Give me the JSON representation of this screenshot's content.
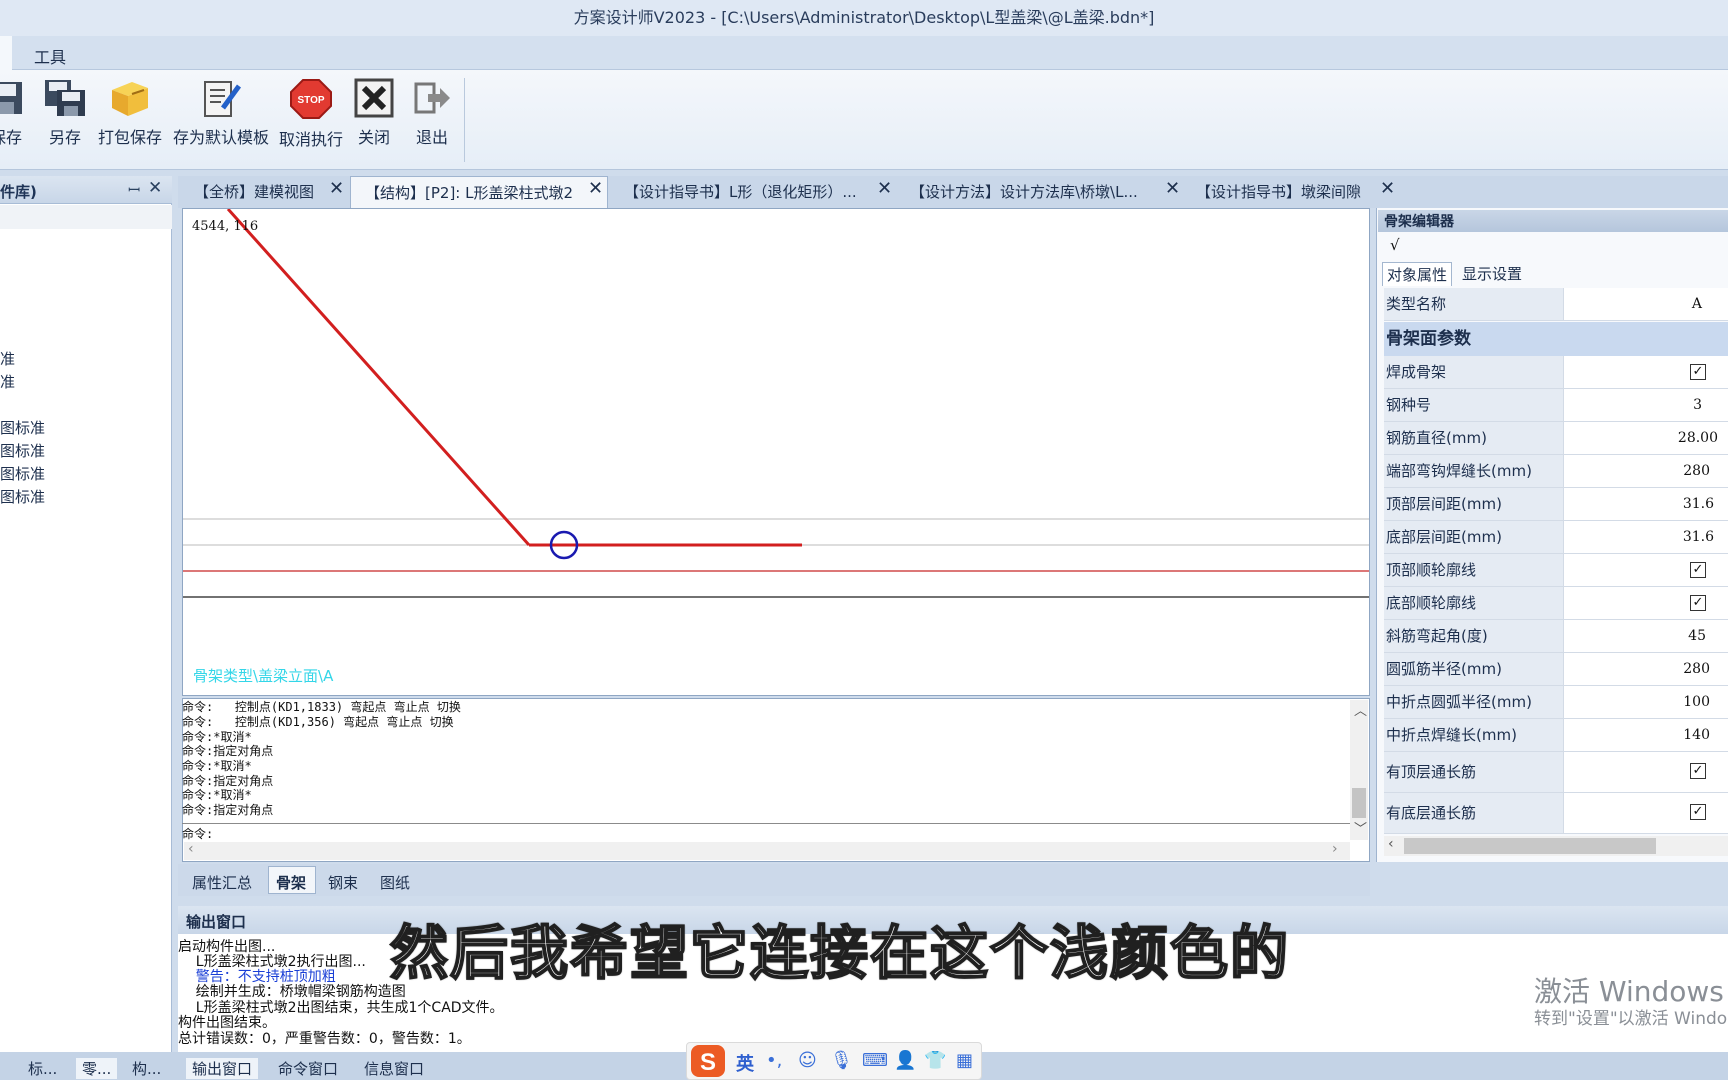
{
  "window": {
    "title": "方案设计师V2023 - [C:\\Users\\Administrator\\Desktop\\L型盖梁\\@L盖梁.bdn*]"
  },
  "menu": {
    "tools": "工具"
  },
  "toolbar": {
    "save": "保存",
    "save_as": "另存",
    "pack_save": "打包保存",
    "save_default_template": "存为默认模板",
    "cancel_exec": "取消执行",
    "close": "关闭",
    "exit": "退出"
  },
  "left_panel": {
    "title": "件库)",
    "items": [
      "准",
      "准",
      "图标准",
      "图标准",
      "图标准",
      "图标准"
    ]
  },
  "doc_tabs": [
    "【全桥】建模视图",
    "【结构】[P2]: L形盖梁柱式墩2",
    "【设计指导书】L形（退化矩形）...",
    "【设计方法】设计方法库\\桥墩\\L...",
    "【设计指导书】墩梁间隙"
  ],
  "canvas": {
    "coords": "4544, 116",
    "label": "骨架类型\\盖梁立面\\A"
  },
  "command": {
    "lines": [
      "命令:   控制点(KD1,1833) 弯起点 弯止点 切换",
      "命令:   控制点(KD1,356) 弯起点 弯止点 切换",
      "命令:*取消*",
      "命令:指定对角点",
      "命令:*取消*",
      "命令:指定对角点",
      "命令:*取消*",
      "命令:指定对角点"
    ],
    "prompt": "命令:"
  },
  "mid_tabs": [
    "属性汇总",
    "骨架",
    "钢束",
    "图纸"
  ],
  "right_panel": {
    "title": "骨架编辑器",
    "tick": "√",
    "tabs": [
      "对象属性",
      "显示设置"
    ],
    "type_name_label": "类型名称",
    "type_name_value": "A",
    "section": "骨架面参数",
    "props": [
      {
        "label": "焊成骨架",
        "value": "✓"
      },
      {
        "label": "钢种号",
        "value": "3"
      },
      {
        "label": "钢筋直径(mm)",
        "value": "28.00"
      },
      {
        "label": "端部弯钩焊缝长(mm)",
        "value": "280"
      },
      {
        "label": "顶部层间距(mm)",
        "value": "31.6"
      },
      {
        "label": "底部层间距(mm)",
        "value": "31.6"
      },
      {
        "label": "顶部顺轮廓线",
        "value": "✓"
      },
      {
        "label": "底部顺轮廓线",
        "value": "✓"
      },
      {
        "label": "斜筋弯起角(度)",
        "value": "45"
      },
      {
        "label": "圆弧筋半径(mm)",
        "value": "280"
      },
      {
        "label": "中折点圆弧半径(mm)",
        "value": "100"
      },
      {
        "label": "中折点焊缝长(mm)",
        "value": "140"
      },
      {
        "label": "有顶层通长筋",
        "value": "✓"
      },
      {
        "label": "有底层通长筋",
        "value": "✓"
      }
    ]
  },
  "output": {
    "title": "输出窗口",
    "lines": [
      "启动构件出图...",
      "    L形盖梁柱式墩2执行出图...",
      "    警告：不支持桩顶加粗",
      "    绘制并生成：桥墩帽梁钢筋构造图",
      "    L形盖梁柱式墩2出图结束，共生成1个CAD文件。",
      "构件出图结束。",
      "总计错误数：0，严重警告数：0，警告数：1。"
    ]
  },
  "bottom_tabs": [
    "标...",
    "零...",
    "构...",
    "输出窗口",
    "命令窗口",
    "信息窗口"
  ],
  "subtitle": "然后我希望它连接在这个浅颜色的",
  "watermark": {
    "line1": "激活 Windows",
    "line2": "转到\"设置\"以激活 Windo"
  },
  "ime": {
    "lang": "英",
    "punct": "•,"
  },
  "colors": {
    "accent_red": "#d21f1f",
    "selection_blue": "#1a1ab0",
    "label_cyan": "#33d6e8",
    "warning_blue": "#1a3fd6"
  }
}
